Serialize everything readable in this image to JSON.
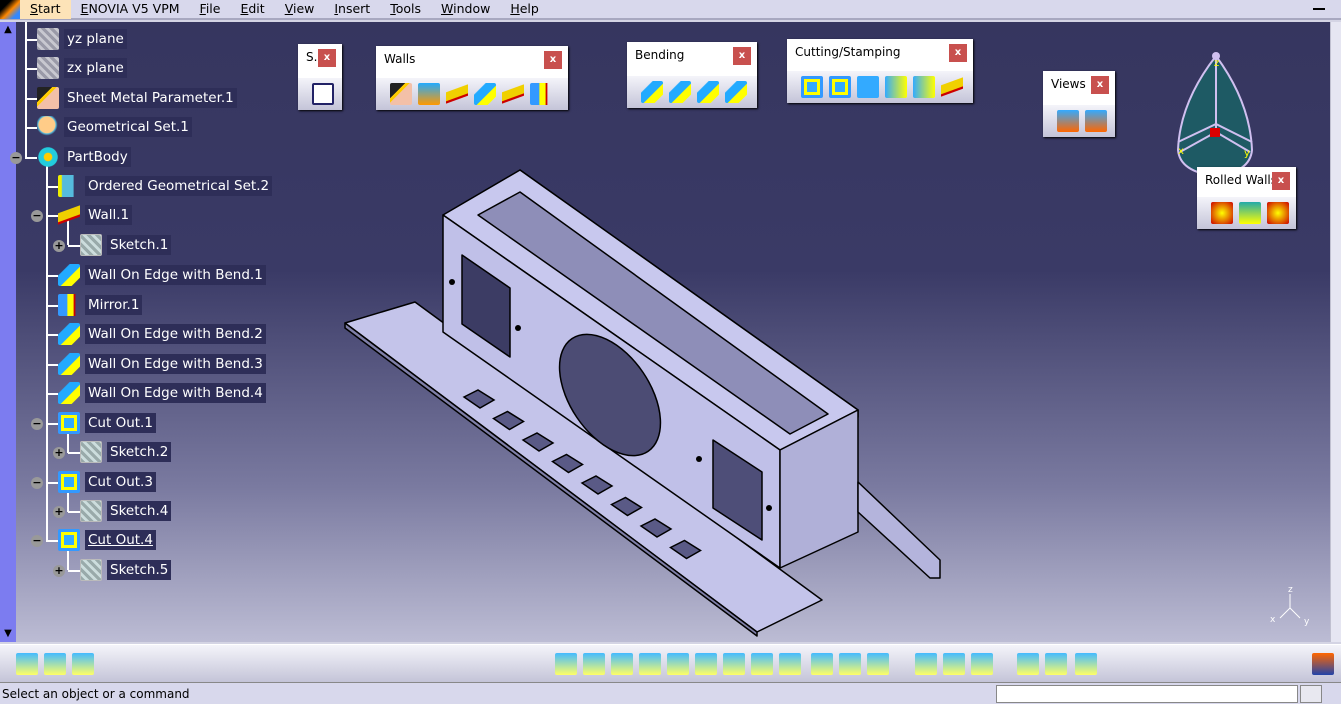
{
  "menu": {
    "items": [
      "Start",
      "ENOVIA V5 VPM",
      "File",
      "Edit",
      "View",
      "Insert",
      "Tools",
      "Window",
      "Help"
    ]
  },
  "tree": [
    {
      "label": "yz plane",
      "level": 0,
      "icon": "plane-icon"
    },
    {
      "label": "zx plane",
      "level": 0,
      "icon": "plane-icon"
    },
    {
      "label": "Sheet Metal Parameter.1",
      "level": 0,
      "icon": "sheet-metal-parameter-icon"
    },
    {
      "label": "Geometrical Set.1",
      "level": 0,
      "icon": "geometrical-set-icon"
    },
    {
      "label": "PartBody",
      "level": 0,
      "icon": "part-body-icon",
      "expanded": true
    },
    {
      "label": "Ordered Geometrical Set.2",
      "level": 1,
      "icon": "ordered-geometrical-set-icon"
    },
    {
      "label": "Wall.1",
      "level": 1,
      "icon": "wall-icon",
      "expanded": true
    },
    {
      "label": "Sketch.1",
      "level": 2,
      "icon": "sketch-icon",
      "collapsed": true
    },
    {
      "label": "Wall On Edge with Bend.1",
      "level": 1,
      "icon": "wall-on-edge-icon"
    },
    {
      "label": "Mirror.1",
      "level": 1,
      "icon": "mirror-icon"
    },
    {
      "label": "Wall On Edge with Bend.2",
      "level": 1,
      "icon": "wall-on-edge-icon"
    },
    {
      "label": "Wall On Edge with Bend.3",
      "level": 1,
      "icon": "wall-on-edge-icon"
    },
    {
      "label": "Wall On Edge with Bend.4",
      "level": 1,
      "icon": "wall-on-edge-icon"
    },
    {
      "label": "Cut Out.1",
      "level": 1,
      "icon": "cut-out-icon",
      "expanded": true
    },
    {
      "label": "Sketch.2",
      "level": 2,
      "icon": "sketch-icon",
      "collapsed": true
    },
    {
      "label": "Cut Out.3",
      "level": 1,
      "icon": "cut-out-icon",
      "expanded": true
    },
    {
      "label": "Sketch.4",
      "level": 2,
      "icon": "sketch-icon",
      "collapsed": true
    },
    {
      "label": "Cut Out.4",
      "level": 1,
      "icon": "cut-out-icon",
      "expanded": true,
      "current": true
    },
    {
      "label": "Sketch.5",
      "level": 2,
      "icon": "sketch-icon",
      "collapsed": true
    }
  ],
  "toolbars": {
    "sketcher": {
      "title": "S...",
      "close": "x"
    },
    "walls": {
      "title": "Walls",
      "close": "x"
    },
    "bending": {
      "title": "Bending",
      "close": "x"
    },
    "cutting": {
      "title": "Cutting/Stamping",
      "close": "x"
    },
    "views": {
      "title": "Views",
      "close": "x"
    },
    "rolled": {
      "title": "Rolled Walls",
      "close": "x"
    }
  },
  "compass": {
    "labels": [
      "z",
      "x",
      "y"
    ]
  },
  "axis_triad": {
    "labels": [
      "z",
      "x",
      "y"
    ]
  },
  "status": {
    "text": "Select an object or a command",
    "command_value": ""
  },
  "colors": {
    "background_top": "#36365f",
    "background_bottom": "#bcbcd4",
    "part": "#c8c8ec",
    "compass": "#1e5a64"
  }
}
